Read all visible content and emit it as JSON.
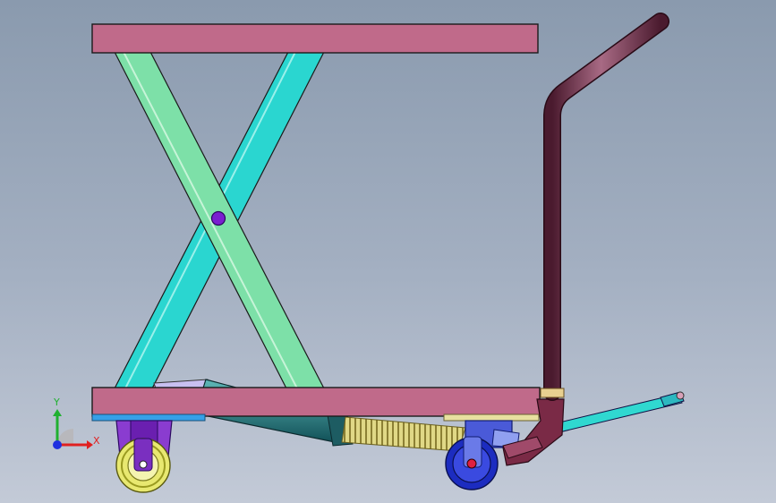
{
  "scene": {
    "model": "scissor-lift-table-cart",
    "colors": {
      "background_top": "#8a9aae",
      "background_bottom": "#c3cad7",
      "platform": "#c06a8a",
      "outline": "#1a1a1a",
      "arm_front": "#7de0a8",
      "arm_back": "#2ad6d0",
      "pivot": "#7a1fd0",
      "handle": "#6a2a42",
      "cylinder": "#1e6a70",
      "spring": "#d8d070",
      "front_caster_tire": "#e8e870",
      "front_caster_hub": "#7a2fc0",
      "rear_caster_tire": "#1c2cc0",
      "tow_rod": "#30d8d0"
    }
  },
  "triad": {
    "x_label": "X",
    "y_label": "Y",
    "x_color": "#e02020",
    "y_color": "#20b030",
    "z_color": "#2030e0"
  }
}
